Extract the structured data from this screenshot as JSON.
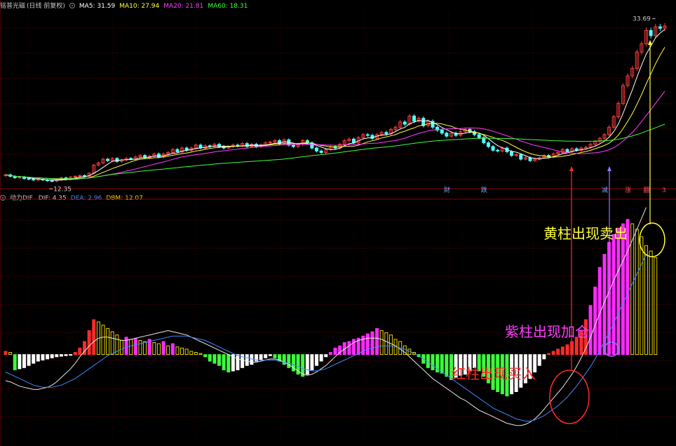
{
  "price_panel": {
    "stock_title": "铭普光磁",
    "adjust_note": "(日线 前复权)",
    "ma": [
      {
        "label": "MA5: 31.59",
        "color": "#ffffff"
      },
      {
        "label": "MA10: 27.94",
        "color": "#ffff3c"
      },
      {
        "label": "MA20: 21.81",
        "color": "#ff3cff"
      },
      {
        "label": "MA60: 18.31",
        "color": "#3cff3c"
      }
    ],
    "high_label": "33.69",
    "low_label": "12.35",
    "event_labels": [
      {
        "text": "财",
        "day": 95,
        "color": "#6fa8ff"
      },
      {
        "text": "跌",
        "day": 103,
        "color": "#6fa8ff"
      },
      {
        "text": "减",
        "day": 129,
        "color": "#6fa8ff"
      },
      {
        "text": "涨",
        "day": 134,
        "color": "#ff5050"
      },
      {
        "text": "翻",
        "day": 138,
        "color": "#ff5050"
      },
      {
        "text": "3",
        "day": 142,
        "color": "#ff5050"
      }
    ]
  },
  "indicator_panel": {
    "name": "动力DIF",
    "values": [
      {
        "label": "DIF: 4.35",
        "color": "#c8c8c8"
      },
      {
        "label": "DEA: 2.96",
        "color": "#3c8cff"
      },
      {
        "label": "DBM: 12.07",
        "color": "#e6d200"
      }
    ]
  },
  "annotations": [
    {
      "text": "黄柱出现卖出",
      "color": "#ffff3c"
    },
    {
      "text": "紫柱出现加仓",
      "color": "#ff3cff"
    },
    {
      "text": "红柱出现买入",
      "color": "#ff2a2a"
    }
  ],
  "chart_data": [
    {
      "type": "candlestick",
      "ylim": [
        12,
        35
      ],
      "close": [
        13.2,
        13.0,
        12.8,
        12.9,
        12.7,
        12.6,
        12.5,
        12.6,
        12.5,
        12.4,
        12.35,
        12.5,
        12.8,
        12.6,
        12.9,
        13.0,
        13.1,
        13.0,
        13.4,
        14.5,
        14.8,
        15.3,
        15.1,
        15.4,
        15.0,
        15.2,
        15.4,
        15.3,
        15.6,
        15.8,
        15.5,
        15.7,
        16.0,
        15.6,
        16.0,
        16.2,
        16.6,
        16.3,
        16.8,
        16.5,
        16.8,
        17.2,
        16.8,
        17.1,
        17.0,
        17.3,
        17.0,
        16.8,
        17.0,
        17.2,
        17.1,
        17.4,
        17.0,
        17.3,
        17.0,
        17.2,
        17.5,
        17.6,
        17.8,
        17.4,
        17.9,
        17.2,
        17.0,
        17.3,
        17.8,
        17.5,
        16.8,
        16.4,
        16.2,
        16.6,
        17.0,
        16.8,
        17.3,
        17.8,
        18.0,
        17.5,
        18.2,
        18.6,
        18.5,
        18.1,
        18.6,
        18.9,
        18.7,
        19.3,
        19.6,
        20.3,
        20.0,
        21.1,
        20.4,
        20.8,
        19.8,
        20.4,
        19.6,
        19.2,
        18.8,
        18.4,
        18.8,
        18.5,
        19.0,
        19.3,
        19.0,
        18.6,
        18.2,
        17.5,
        17.0,
        16.5,
        16.4,
        16.8,
        16.3,
        15.8,
        15.9,
        15.3,
        15.5,
        15.1,
        15.3,
        15.5,
        15.8,
        15.6,
        16.0,
        16.2,
        16.6,
        16.3,
        16.7,
        16.5,
        16.8,
        16.9,
        17.3,
        17.7,
        18.1,
        18.6,
        19.6,
        21.0,
        22.8,
        25.2,
        26.5,
        27.5,
        29.7,
        30.8,
        32.6,
        31.9,
        33.1,
        32.9,
        33.2
      ],
      "high_label": "33.69",
      "low_label": "12.35"
    },
    {
      "type": "bar+line",
      "ylim": [
        -8,
        14
      ],
      "histogram": [
        0.3,
        0.2,
        -1.4,
        -1.3,
        -1.2,
        -1.0,
        -0.8,
        -0.6,
        -0.5,
        -0.4,
        -0.3,
        -0.2,
        -0.15,
        -0.1,
        -0.05,
        0.2,
        0.6,
        1.2,
        2.2,
        3.2,
        3.0,
        2.7,
        2.4,
        2.1,
        1.8,
        1.3,
        1.6,
        1.4,
        1.5,
        1.3,
        1.2,
        1.4,
        1.1,
        1.0,
        1.2,
        0.8,
        1.0,
        0.7,
        0.6,
        0.5,
        0.3,
        0.2,
        0.1,
        -0.2,
        -0.6,
        -0.8,
        -1.0,
        -1.4,
        -1.6,
        -1.5,
        -1.4,
        -1.2,
        -1.0,
        -0.9,
        -0.6,
        -0.5,
        -0.3,
        -0.1,
        -0.3,
        -0.6,
        -0.9,
        -1.2,
        -1.5,
        -1.8,
        -2.0,
        -1.8,
        -1.4,
        -1.0,
        -0.6,
        -0.2,
        0.2,
        0.6,
        0.8,
        1.1,
        1.2,
        1.4,
        1.5,
        1.7,
        1.9,
        2.1,
        2.4,
        2.2,
        2.0,
        1.8,
        1.4,
        1.2,
        0.8,
        0.5,
        0.2,
        -0.2,
        -0.8,
        -1.2,
        -1.4,
        -1.6,
        -1.7,
        -2.0,
        -2.3,
        -2.1,
        -1.9,
        -1.8,
        -1.5,
        -1.2,
        -1.5,
        -2.0,
        -2.6,
        -3.2,
        -3.4,
        -3.6,
        -3.8,
        -3.6,
        -3.4,
        -3.0,
        -2.6,
        -2.2,
        -1.6,
        -1.0,
        -0.4,
        0.1,
        0.3,
        0.5,
        0.7,
        0.9,
        1.2,
        1.6,
        2.2,
        3.2,
        4.5,
        6.2,
        8.0,
        9.2,
        10.3,
        11.0,
        11.6,
        12.0,
        12.4,
        12.0,
        11.5,
        10.8,
        10.0,
        9.5,
        8.9
      ],
      "dif": [
        -2.4,
        -2.5,
        -2.7,
        -2.9,
        -3.0,
        -3.1,
        -3.2,
        -3.2,
        -3.1,
        -3.0,
        -2.8,
        -2.5,
        -2.1,
        -1.7,
        -1.3,
        -0.8,
        -0.2,
        0.3,
        0.8,
        1.2,
        1.5,
        1.6,
        1.6,
        1.5,
        1.4,
        1.3,
        1.3,
        1.4,
        1.5,
        1.6,
        1.7,
        1.8,
        1.9,
        2.0,
        2.1,
        2.2,
        2.1,
        2.0,
        1.9,
        1.8,
        1.6,
        1.4,
        1.2,
        1.0,
        0.8,
        0.6,
        0.4,
        0.2,
        0.0,
        -0.2,
        -0.4,
        -0.5,
        -0.6,
        -0.7,
        -0.7,
        -0.6,
        -0.5,
        -0.4,
        -0.4,
        -0.5,
        -0.7,
        -0.9,
        -1.2,
        -1.5,
        -1.8,
        -1.9,
        -1.8,
        -1.6,
        -1.3,
        -1.0,
        -0.6,
        -0.2,
        0.2,
        0.5,
        0.8,
        1.1,
        1.3,
        1.4,
        1.5,
        1.5,
        1.5,
        1.4,
        1.2,
        1.0,
        0.8,
        0.5,
        0.2,
        -0.2,
        -0.6,
        -1.0,
        -1.4,
        -1.8,
        -2.2,
        -2.5,
        -2.8,
        -3.1,
        -3.4,
        -3.7,
        -4.0,
        -4.2,
        -4.5,
        -4.8,
        -5.1,
        -5.3,
        -5.5,
        -5.7,
        -5.9,
        -6.1,
        -6.3,
        -6.4,
        -6.5,
        -6.5,
        -6.4,
        -6.2,
        -5.9,
        -5.5,
        -5.0,
        -4.5,
        -4.0,
        -3.5,
        -3.0,
        -2.4,
        -1.8,
        -1.1,
        -0.3,
        0.6,
        1.6,
        2.7,
        3.8,
        4.8,
        5.8,
        6.8,
        7.7,
        8.6,
        9.5,
        10.5,
        11.5,
        12.5,
        13.5
      ],
      "dea": [
        -1.6,
        -1.8,
        -2.0,
        -2.2,
        -2.4,
        -2.6,
        -2.8,
        -2.9,
        -3.0,
        -3.0,
        -3.0,
        -2.9,
        -2.8,
        -2.6,
        -2.4,
        -2.2,
        -1.9,
        -1.6,
        -1.3,
        -1.0,
        -0.7,
        -0.4,
        -0.1,
        0.1,
        0.3,
        0.5,
        0.7,
        0.8,
        0.9,
        1.0,
        1.1,
        1.2,
        1.3,
        1.4,
        1.5,
        1.6,
        1.7,
        1.7,
        1.7,
        1.7,
        1.6,
        1.5,
        1.4,
        1.3,
        1.1,
        0.9,
        0.7,
        0.5,
        0.3,
        0.1,
        -0.1,
        -0.2,
        -0.3,
        -0.4,
        -0.5,
        -0.5,
        -0.5,
        -0.5,
        -0.5,
        -0.6,
        -0.7,
        -0.8,
        -0.9,
        -1.1,
        -1.3,
        -1.4,
        -1.5,
        -1.5,
        -1.4,
        -1.3,
        -1.1,
        -0.9,
        -0.7,
        -0.5,
        -0.3,
        -0.1,
        0.1,
        0.3,
        0.5,
        0.6,
        0.7,
        0.8,
        0.8,
        0.8,
        0.7,
        0.6,
        0.5,
        0.3,
        0.1,
        -0.1,
        -0.4,
        -0.7,
        -1.0,
        -1.3,
        -1.6,
        -1.9,
        -2.2,
        -2.5,
        -2.8,
        -3.1,
        -3.4,
        -3.7,
        -4.0,
        -4.3,
        -4.6,
        -4.9,
        -5.1,
        -5.3,
        -5.5,
        -5.7,
        -5.9,
        -6.0,
        -6.1,
        -6.1,
        -6.0,
        -5.8,
        -5.6,
        -5.3,
        -5.0,
        -4.7,
        -4.3,
        -3.9,
        -3.4,
        -2.9,
        -2.3,
        -1.7,
        -1.1,
        -0.4,
        0.4,
        1.2,
        2.0,
        2.9,
        3.8,
        4.7,
        5.6,
        6.5,
        7.4,
        8.3,
        9.2
      ]
    }
  ]
}
